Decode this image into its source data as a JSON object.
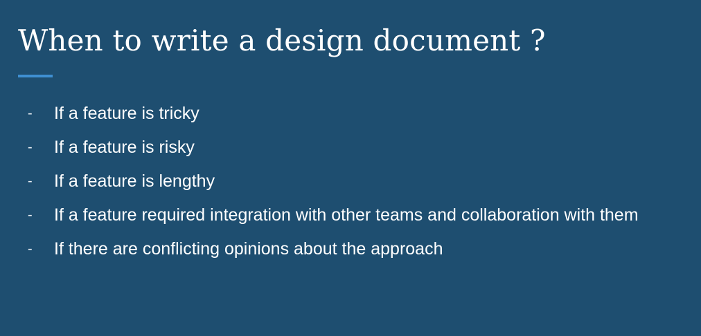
{
  "slide": {
    "title": "When to write a design document ?",
    "bullet_marker": "-",
    "bullets": [
      "If a feature is tricky",
      "If a feature is risky",
      "If a feature is lengthy",
      "If a feature required integration with other teams and collaboration with them",
      "If there are conflicting opinions about the approach"
    ]
  },
  "colors": {
    "background": "#1e4e70",
    "accent": "#3f8fd2",
    "text": "#ffffff"
  }
}
